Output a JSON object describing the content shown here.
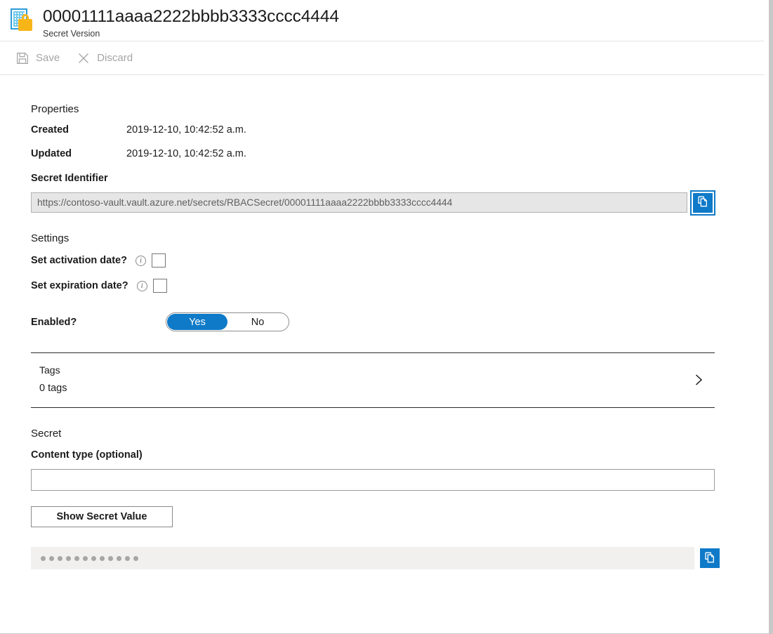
{
  "header": {
    "title": "00001111aaaa2222bbbb3333cccc4444",
    "subtitle": "Secret Version",
    "icon": "secret-version-icon"
  },
  "command_bar": {
    "save_label": "Save",
    "save_icon": "save-floppy-icon",
    "discard_label": "Discard",
    "discard_icon": "close-x-icon",
    "save_enabled": false,
    "discard_enabled": false
  },
  "properties": {
    "heading": "Properties",
    "rows": [
      {
        "label": "Created",
        "value": "2019-12-10, 10:42:52 a.m."
      },
      {
        "label": "Updated",
        "value": "2019-12-10, 10:42:52 a.m."
      }
    ],
    "identifier_label": "Secret Identifier",
    "identifier_value": "https://contoso-vault.vault.azure.net/secrets/RBACSecret/00001111aaaa2222bbbb3333cccc4444",
    "identifier_copy_icon": "copy-icon"
  },
  "settings": {
    "heading": "Settings",
    "activation_label": "Set activation date?",
    "activation_info_icon": "info-icon",
    "activation_checked": false,
    "expiration_label": "Set expiration date?",
    "expiration_info_icon": "info-icon",
    "expiration_checked": false,
    "enabled_label": "Enabled?",
    "enabled_yes": "Yes",
    "enabled_no": "No",
    "enabled_selected": "Yes"
  },
  "tags": {
    "title": "Tags",
    "count_label": "0 tags",
    "chevron_icon": "chevron-right-icon"
  },
  "secret": {
    "heading": "Secret",
    "content_type_label": "Content type (optional)",
    "content_type_value": "",
    "content_type_placeholder": "",
    "show_value_button": "Show Secret Value",
    "masked_value": "••••••••••••",
    "masked_dot_count": 12,
    "copy_icon": "copy-icon"
  },
  "colors": {
    "accent_blue": "#0f7ac8",
    "icon_blue": "#2e9bd6",
    "lock_yellow": "#f7b518",
    "disabled_gray": "#a5a5a5",
    "readonly_bg": "#e6e6e6",
    "secret_bg": "#f1f0ef"
  }
}
